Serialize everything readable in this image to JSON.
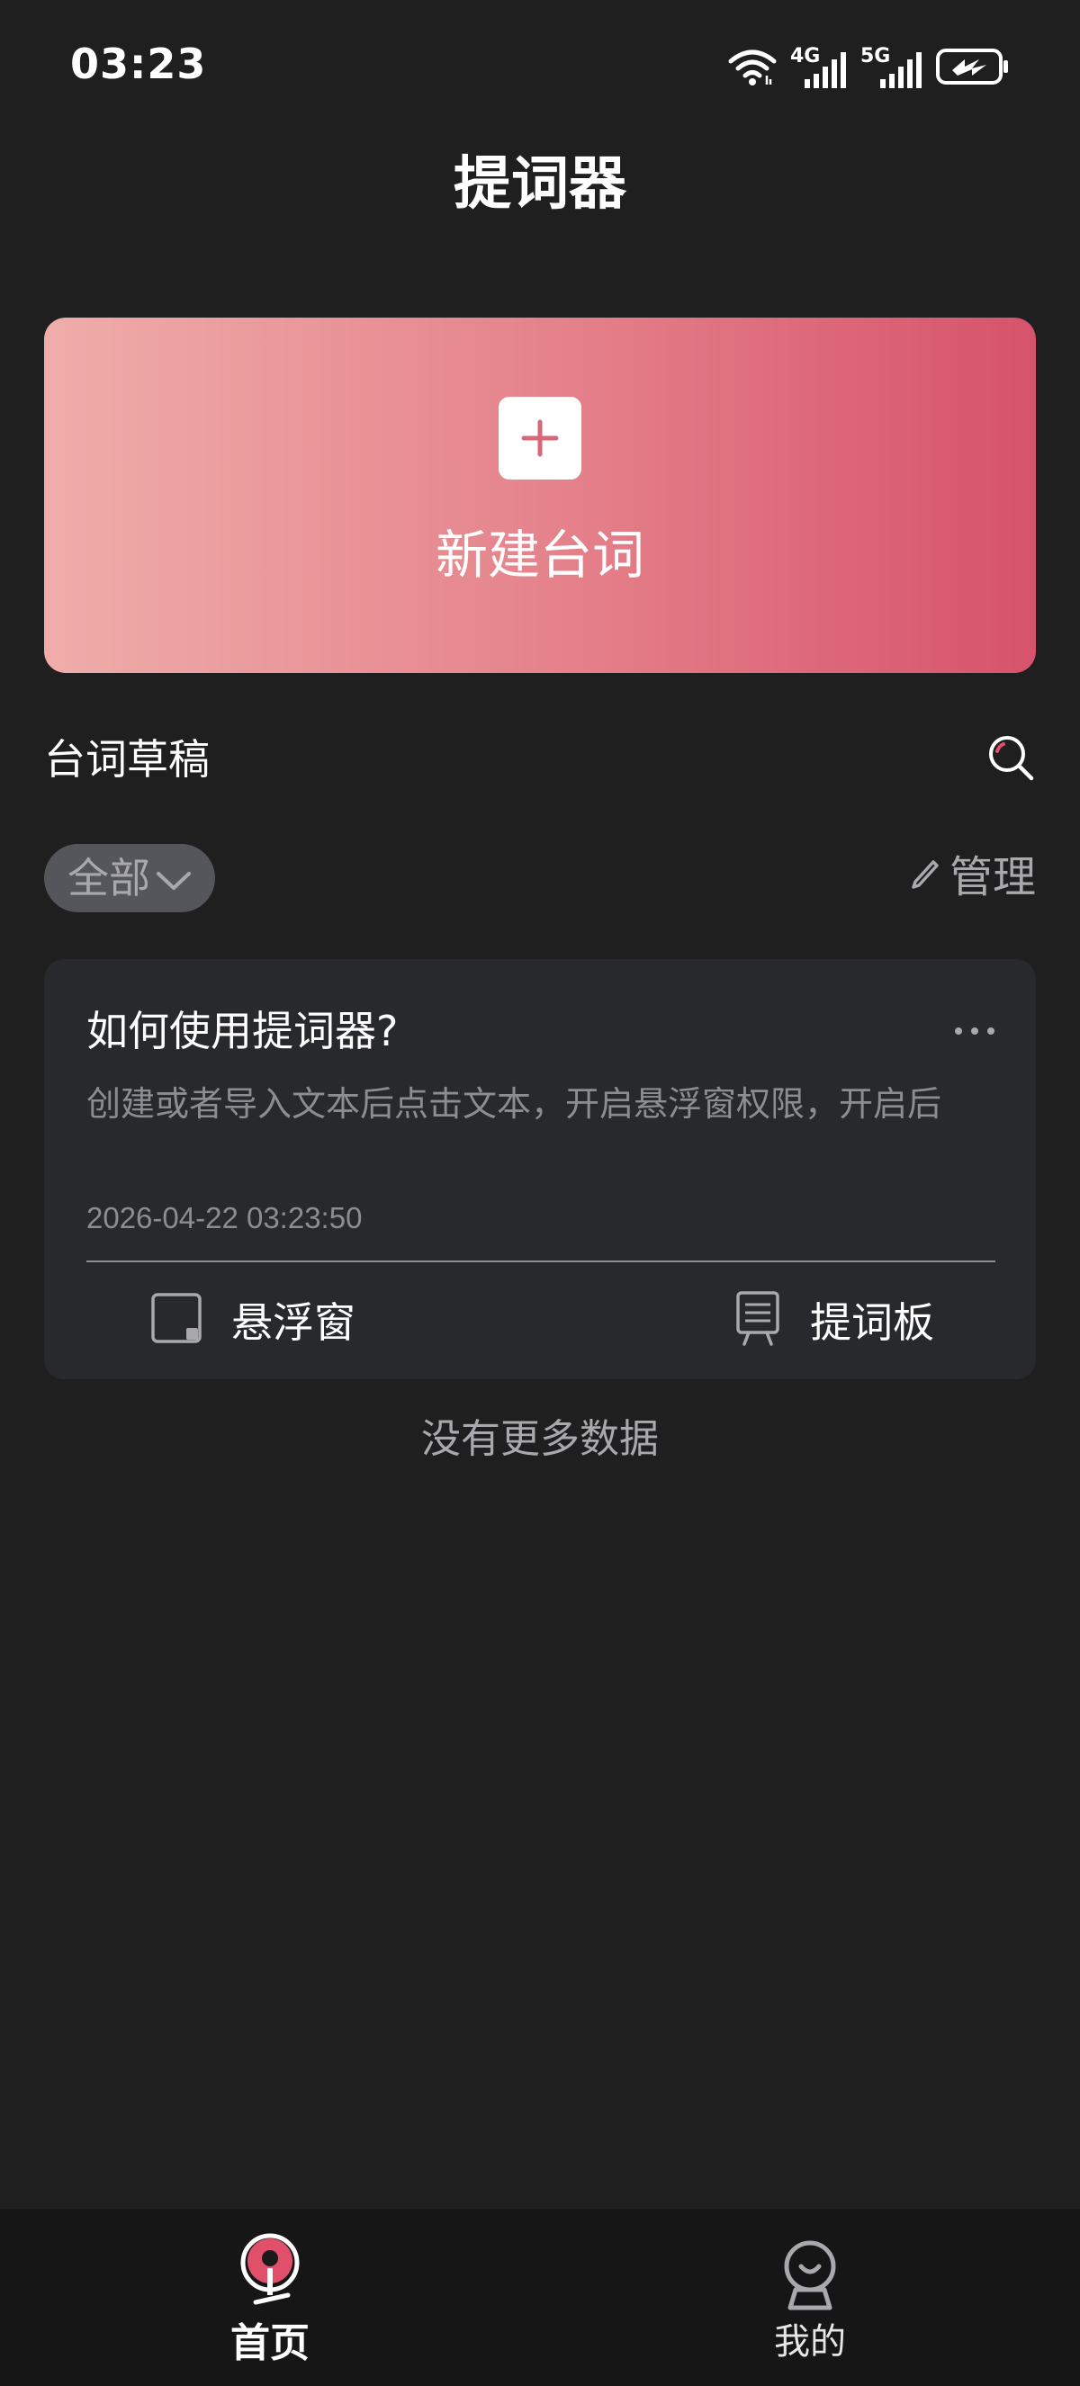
{
  "status_bar": {
    "time": "03:23",
    "network_1": "4G",
    "network_2": "5G"
  },
  "header": {
    "title": "提词器"
  },
  "create_banner": {
    "label": "新建台词",
    "gradient_start": "#efadaa",
    "gradient_end": "#d6536b"
  },
  "drafts": {
    "section_title": "台词草稿",
    "filter_label": "全部",
    "manage_label": "管理",
    "no_more_text": "没有更多数据",
    "items": [
      {
        "title": "如何使用提词器?",
        "excerpt": "创建或者导入文本后点击文本，开启悬浮窗权限，开启后",
        "date": "2026-04-22 03:23:50",
        "action_float_label": "悬浮窗",
        "action_board_label": "提词板"
      }
    ]
  },
  "bottom_nav": {
    "home_label": "首页",
    "mine_label": "我的",
    "accent_color": "#e0506a"
  },
  "icons": [
    "wifi-icon",
    "signal-4g-icon",
    "signal-5g-icon",
    "battery-charging-icon",
    "plus-icon",
    "search-icon",
    "chevron-down-icon",
    "edit-pencil-icon",
    "more-dots-icon",
    "floating-window-icon",
    "teleprompter-board-icon",
    "home-pin-icon",
    "profile-icon"
  ]
}
